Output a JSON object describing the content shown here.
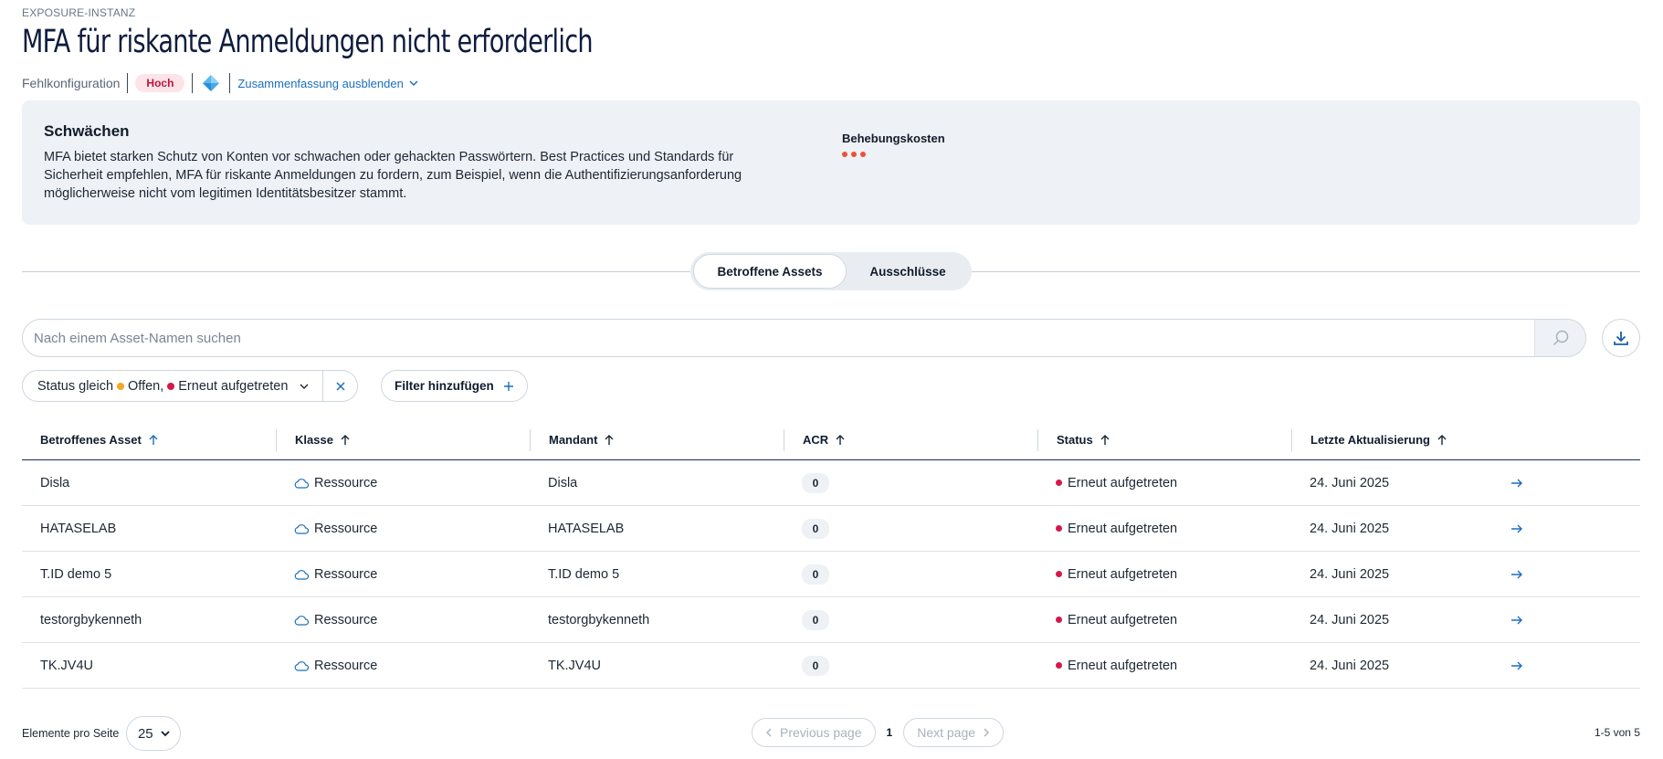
{
  "header": {
    "eyebrow": "EXPOSURE-INSTANZ",
    "title": "MFA für riskante Anmeldungen nicht erforderlich",
    "type": "Fehlkonfiguration",
    "severity": "Hoch",
    "platform_icon": "azure-cube-icon",
    "summary_toggle": "Zusammenfassung ausblenden"
  },
  "weakness": {
    "title": "Schwächen",
    "text": "MFA bietet starken Schutz von Konten vor schwachen oder gehackten Passwörtern. Best Practices und Standards für Sicherheit empfehlen, MFA für riskante Anmeldungen zu fordern, zum Beispiel, wenn die Authentifizierungsanforderung möglicherweise nicht vom legitimen Identitätsbesitzer stammt.",
    "cost_label": "Behebungskosten",
    "cost_level": 3,
    "cost_color": "#e8533a"
  },
  "tabs": [
    {
      "label": "Betroffene Assets",
      "active": true
    },
    {
      "label": "Ausschlüsse",
      "active": false
    }
  ],
  "search": {
    "placeholder": "Nach einem Asset-Namen suchen"
  },
  "filters": {
    "status_prefix": "Status gleich",
    "status_open": "Offen,",
    "status_open_color": "#f5a623",
    "status_reopened": "Erneut aufgetreten",
    "status_reopened_color": "#d6174a",
    "add_filter": "Filter hinzufügen"
  },
  "table": {
    "columns": [
      "Betroffenes Asset",
      "Klasse",
      "Mandant",
      "ACR",
      "Status",
      "Letzte Aktualisierung"
    ],
    "rows": [
      {
        "asset": "Disla",
        "class": "Ressource",
        "tenant": "Disla",
        "acr": "0",
        "status": "Erneut aufgetreten",
        "updated": "24. Juni 2025"
      },
      {
        "asset": "HATASELAB",
        "class": "Ressource",
        "tenant": "HATASELAB",
        "acr": "0",
        "status": "Erneut aufgetreten",
        "updated": "24. Juni 2025"
      },
      {
        "asset": "T.ID demo 5",
        "class": "Ressource",
        "tenant": "T.ID demo 5",
        "acr": "0",
        "status": "Erneut aufgetreten",
        "updated": "24. Juni 2025"
      },
      {
        "asset": "testorgbykenneth",
        "class": "Ressource",
        "tenant": "testorgbykenneth",
        "acr": "0",
        "status": "Erneut aufgetreten",
        "updated": "24. Juni 2025"
      },
      {
        "asset": "TK.JV4U",
        "class": "Ressource",
        "tenant": "TK.JV4U",
        "acr": "0",
        "status": "Erneut aufgetreten",
        "updated": "24. Juni 2025"
      }
    ]
  },
  "footer": {
    "per_page_label": "Elemente pro Seite",
    "per_page_value": "25",
    "prev": "Previous page",
    "current_page": "1",
    "next": "Next page",
    "range": "1-5 von 5"
  }
}
